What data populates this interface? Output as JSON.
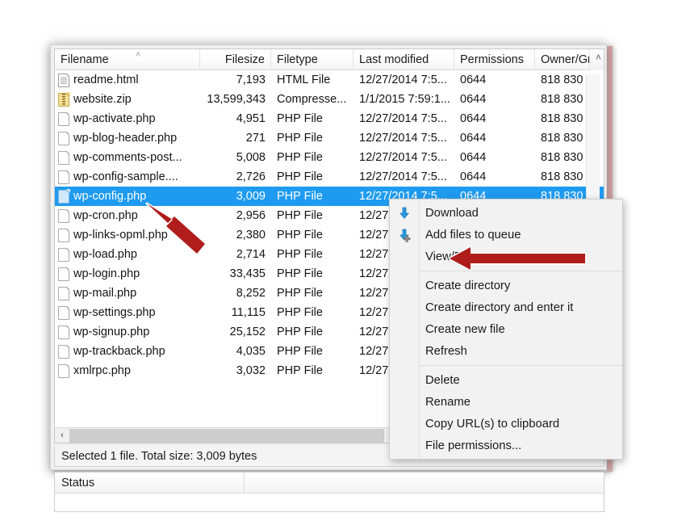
{
  "window": {
    "accent_color": "#dda3a3",
    "selection_color": "#1e9bf0"
  },
  "file_list": {
    "sort_caret": "˄",
    "scroll_caret": "˄",
    "columns": [
      {
        "key": "filename",
        "label": "Filename"
      },
      {
        "key": "filesize",
        "label": "Filesize"
      },
      {
        "key": "filetype",
        "label": "Filetype"
      },
      {
        "key": "modified",
        "label": "Last modified"
      },
      {
        "key": "permissions",
        "label": "Permissions"
      },
      {
        "key": "owner",
        "label": "Owner/Gro"
      }
    ],
    "rows": [
      {
        "icon": "html-file-icon",
        "filename": "readme.html",
        "filesize": "7,193",
        "filetype": "HTML File",
        "modified": "12/27/2014 7:5...",
        "permissions": "0644",
        "owner": "818 830",
        "selected": false
      },
      {
        "icon": "zip-file-icon",
        "filename": "website.zip",
        "filesize": "13,599,343",
        "filetype": "Compresse...",
        "modified": "1/1/2015 7:59:1...",
        "permissions": "0644",
        "owner": "818 830",
        "selected": false
      },
      {
        "icon": "php-file-icon",
        "filename": "wp-activate.php",
        "filesize": "4,951",
        "filetype": "PHP File",
        "modified": "12/27/2014 7:5...",
        "permissions": "0644",
        "owner": "818 830",
        "selected": false
      },
      {
        "icon": "php-file-icon",
        "filename": "wp-blog-header.php",
        "filesize": "271",
        "filetype": "PHP File",
        "modified": "12/27/2014 7:5...",
        "permissions": "0644",
        "owner": "818 830",
        "selected": false
      },
      {
        "icon": "php-file-icon",
        "filename": "wp-comments-post...",
        "filesize": "5,008",
        "filetype": "PHP File",
        "modified": "12/27/2014 7:5...",
        "permissions": "0644",
        "owner": "818 830",
        "selected": false
      },
      {
        "icon": "php-file-icon",
        "filename": "wp-config-sample....",
        "filesize": "2,726",
        "filetype": "PHP File",
        "modified": "12/27/2014 7:5...",
        "permissions": "0644",
        "owner": "818 830",
        "selected": false
      },
      {
        "icon": "php-file-icon",
        "filename": "wp-config.php",
        "filesize": "3,009",
        "filetype": "PHP File",
        "modified": "12/27/2014 7:5...",
        "permissions": "0644",
        "owner": "818 830",
        "selected": true
      },
      {
        "icon": "php-file-icon",
        "filename": "wp-cron.php",
        "filesize": "2,956",
        "filetype": "PHP File",
        "modified": "12/27",
        "permissions": "",
        "owner": "",
        "selected": false
      },
      {
        "icon": "php-file-icon",
        "filename": "wp-links-opml.php",
        "filesize": "2,380",
        "filetype": "PHP File",
        "modified": "12/27",
        "permissions": "",
        "owner": "",
        "selected": false
      },
      {
        "icon": "php-file-icon",
        "filename": "wp-load.php",
        "filesize": "2,714",
        "filetype": "PHP File",
        "modified": "12/27",
        "permissions": "",
        "owner": "",
        "selected": false
      },
      {
        "icon": "php-file-icon",
        "filename": "wp-login.php",
        "filesize": "33,435",
        "filetype": "PHP File",
        "modified": "12/27",
        "permissions": "",
        "owner": "",
        "selected": false
      },
      {
        "icon": "php-file-icon",
        "filename": "wp-mail.php",
        "filesize": "8,252",
        "filetype": "PHP File",
        "modified": "12/27",
        "permissions": "",
        "owner": "",
        "selected": false
      },
      {
        "icon": "php-file-icon",
        "filename": "wp-settings.php",
        "filesize": "11,115",
        "filetype": "PHP File",
        "modified": "12/27",
        "permissions": "",
        "owner": "",
        "selected": false
      },
      {
        "icon": "php-file-icon",
        "filename": "wp-signup.php",
        "filesize": "25,152",
        "filetype": "PHP File",
        "modified": "12/27",
        "permissions": "",
        "owner": "",
        "selected": false
      },
      {
        "icon": "php-file-icon",
        "filename": "wp-trackback.php",
        "filesize": "4,035",
        "filetype": "PHP File",
        "modified": "12/27",
        "permissions": "",
        "owner": "",
        "selected": false
      },
      {
        "icon": "php-file-icon",
        "filename": "xmlrpc.php",
        "filesize": "3,032",
        "filetype": "PHP File",
        "modified": "12/27",
        "permissions": "",
        "owner": "",
        "selected": false
      }
    ],
    "hscroll_left_caret": "‹"
  },
  "selection_status": {
    "text": "Selected 1 file. Total size: 3,009 bytes"
  },
  "status_pane": {
    "column_label": "Status"
  },
  "context_menu": {
    "items": [
      {
        "label": "Download",
        "icon": "download-arrow-icon",
        "separator_after": false
      },
      {
        "label": "Add files to queue",
        "icon": "add-to-queue-arrow-icon",
        "separator_after": false
      },
      {
        "label": "View/Edit",
        "icon": "",
        "separator_after": true
      },
      {
        "label": "Create directory",
        "icon": "",
        "separator_after": false
      },
      {
        "label": "Create directory and enter it",
        "icon": "",
        "separator_after": false
      },
      {
        "label": "Create new file",
        "icon": "",
        "separator_after": false
      },
      {
        "label": "Refresh",
        "icon": "",
        "separator_after": true
      },
      {
        "label": "Delete",
        "icon": "",
        "separator_after": false
      },
      {
        "label": "Rename",
        "icon": "",
        "separator_after": false
      },
      {
        "label": "Copy URL(s) to clipboard",
        "icon": "",
        "separator_after": false
      },
      {
        "label": "File permissions...",
        "icon": "",
        "separator_after": false
      }
    ]
  },
  "annotations": {
    "color": "#b01d1d",
    "arrow_to_selected_file": "arrow pointing to wp-config.php row",
    "arrow_to_view_edit": "arrow pointing to View/Edit menu item"
  }
}
